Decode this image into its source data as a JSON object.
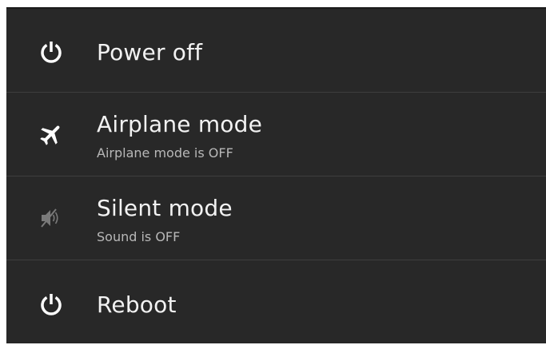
{
  "power_menu": {
    "items": [
      {
        "label": "Power off",
        "icon": "power-icon"
      },
      {
        "label": "Airplane mode",
        "sublabel": "Airplane mode is OFF",
        "icon": "airplane-icon"
      },
      {
        "label": "Silent mode",
        "sublabel": "Sound is OFF",
        "icon": "sound-off-icon"
      },
      {
        "label": "Reboot",
        "icon": "power-icon"
      }
    ]
  },
  "colors": {
    "background": "#282828",
    "divider": "#3e3e3e",
    "text": "#f2f2f2",
    "subtext": "#b8b8b8"
  }
}
